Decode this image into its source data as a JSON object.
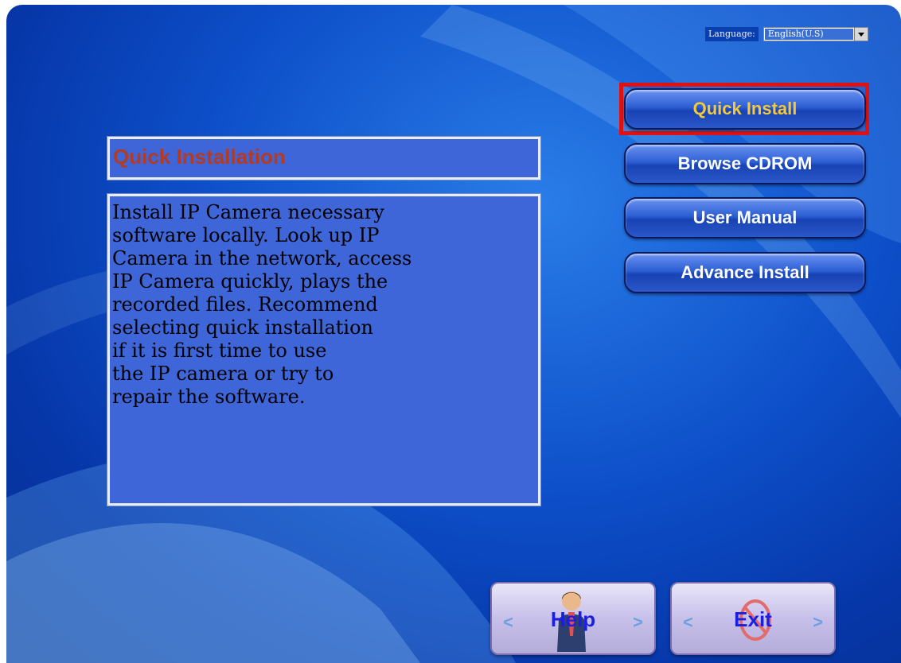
{
  "language": {
    "label": "Language:",
    "selected": "English(U.S)"
  },
  "panel": {
    "title": "Quick Installation",
    "description": "Install IP Camera necessary\nsoftware locally. Look up IP\nCamera in the network, access\nIP Camera quickly, plays the\nrecorded files. Recommend\nselecting quick installation\nif it is first time to use\nthe IP camera or try to\nrepair the software."
  },
  "menu": {
    "quick_install": "Quick Install",
    "browse_cdrom": "Browse CDROM",
    "user_manual": "User Manual",
    "advance_install": "Advance Install"
  },
  "footer": {
    "help": "Help",
    "exit": "Exit"
  },
  "colors": {
    "accent_active_text": "#f4c838",
    "highlight_border": "#e21111",
    "title_text": "#b43a22"
  },
  "icons": {
    "help": "person-icon",
    "exit": "no-entry-icon",
    "arrows": "chevron-icon"
  }
}
